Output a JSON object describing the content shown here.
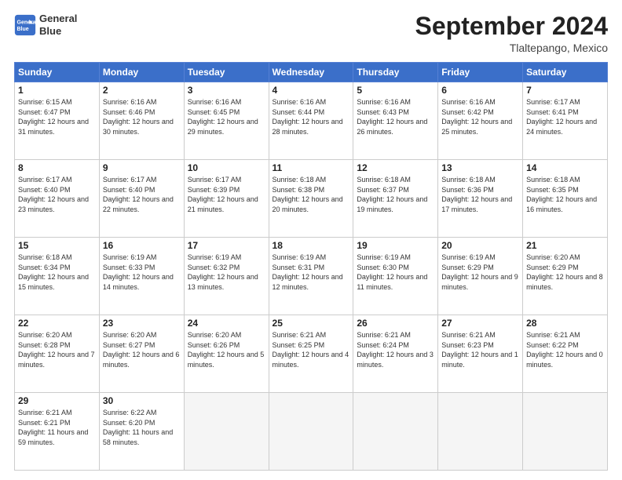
{
  "header": {
    "logo_line1": "General",
    "logo_line2": "Blue",
    "month": "September 2024",
    "location": "Tlaltepango, Mexico"
  },
  "days_of_week": [
    "Sunday",
    "Monday",
    "Tuesday",
    "Wednesday",
    "Thursday",
    "Friday",
    "Saturday"
  ],
  "weeks": [
    [
      {
        "num": "1",
        "rise": "6:15 AM",
        "set": "6:47 PM",
        "daylight": "12 hours and 31 minutes."
      },
      {
        "num": "2",
        "rise": "6:16 AM",
        "set": "6:46 PM",
        "daylight": "12 hours and 30 minutes."
      },
      {
        "num": "3",
        "rise": "6:16 AM",
        "set": "6:45 PM",
        "daylight": "12 hours and 29 minutes."
      },
      {
        "num": "4",
        "rise": "6:16 AM",
        "set": "6:44 PM",
        "daylight": "12 hours and 28 minutes."
      },
      {
        "num": "5",
        "rise": "6:16 AM",
        "set": "6:43 PM",
        "daylight": "12 hours and 26 minutes."
      },
      {
        "num": "6",
        "rise": "6:16 AM",
        "set": "6:42 PM",
        "daylight": "12 hours and 25 minutes."
      },
      {
        "num": "7",
        "rise": "6:17 AM",
        "set": "6:41 PM",
        "daylight": "12 hours and 24 minutes."
      }
    ],
    [
      {
        "num": "8",
        "rise": "6:17 AM",
        "set": "6:40 PM",
        "daylight": "12 hours and 23 minutes."
      },
      {
        "num": "9",
        "rise": "6:17 AM",
        "set": "6:40 PM",
        "daylight": "12 hours and 22 minutes."
      },
      {
        "num": "10",
        "rise": "6:17 AM",
        "set": "6:39 PM",
        "daylight": "12 hours and 21 minutes."
      },
      {
        "num": "11",
        "rise": "6:18 AM",
        "set": "6:38 PM",
        "daylight": "12 hours and 20 minutes."
      },
      {
        "num": "12",
        "rise": "6:18 AM",
        "set": "6:37 PM",
        "daylight": "12 hours and 19 minutes."
      },
      {
        "num": "13",
        "rise": "6:18 AM",
        "set": "6:36 PM",
        "daylight": "12 hours and 17 minutes."
      },
      {
        "num": "14",
        "rise": "6:18 AM",
        "set": "6:35 PM",
        "daylight": "12 hours and 16 minutes."
      }
    ],
    [
      {
        "num": "15",
        "rise": "6:18 AM",
        "set": "6:34 PM",
        "daylight": "12 hours and 15 minutes."
      },
      {
        "num": "16",
        "rise": "6:19 AM",
        "set": "6:33 PM",
        "daylight": "12 hours and 14 minutes."
      },
      {
        "num": "17",
        "rise": "6:19 AM",
        "set": "6:32 PM",
        "daylight": "12 hours and 13 minutes."
      },
      {
        "num": "18",
        "rise": "6:19 AM",
        "set": "6:31 PM",
        "daylight": "12 hours and 12 minutes."
      },
      {
        "num": "19",
        "rise": "6:19 AM",
        "set": "6:30 PM",
        "daylight": "12 hours and 11 minutes."
      },
      {
        "num": "20",
        "rise": "6:19 AM",
        "set": "6:29 PM",
        "daylight": "12 hours and 9 minutes."
      },
      {
        "num": "21",
        "rise": "6:20 AM",
        "set": "6:29 PM",
        "daylight": "12 hours and 8 minutes."
      }
    ],
    [
      {
        "num": "22",
        "rise": "6:20 AM",
        "set": "6:28 PM",
        "daylight": "12 hours and 7 minutes."
      },
      {
        "num": "23",
        "rise": "6:20 AM",
        "set": "6:27 PM",
        "daylight": "12 hours and 6 minutes."
      },
      {
        "num": "24",
        "rise": "6:20 AM",
        "set": "6:26 PM",
        "daylight": "12 hours and 5 minutes."
      },
      {
        "num": "25",
        "rise": "6:21 AM",
        "set": "6:25 PM",
        "daylight": "12 hours and 4 minutes."
      },
      {
        "num": "26",
        "rise": "6:21 AM",
        "set": "6:24 PM",
        "daylight": "12 hours and 3 minutes."
      },
      {
        "num": "27",
        "rise": "6:21 AM",
        "set": "6:23 PM",
        "daylight": "12 hours and 1 minute."
      },
      {
        "num": "28",
        "rise": "6:21 AM",
        "set": "6:22 PM",
        "daylight": "12 hours and 0 minutes."
      }
    ],
    [
      {
        "num": "29",
        "rise": "6:21 AM",
        "set": "6:21 PM",
        "daylight": "11 hours and 59 minutes."
      },
      {
        "num": "30",
        "rise": "6:22 AM",
        "set": "6:20 PM",
        "daylight": "11 hours and 58 minutes."
      },
      null,
      null,
      null,
      null,
      null
    ]
  ]
}
